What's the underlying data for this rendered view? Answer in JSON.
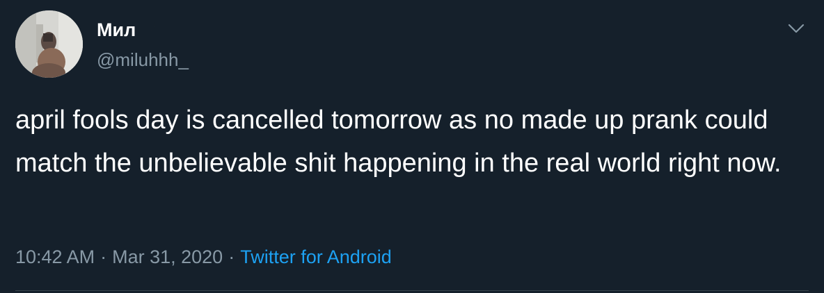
{
  "author": {
    "display_name": "Мил",
    "handle": "@miluhhh_"
  },
  "icons": {
    "avatar": "profile-photo",
    "name_emoji": "crescent-moon-icon",
    "menu": "chevron-down-icon"
  },
  "tweet": {
    "text": "april fools day is cancelled tomorrow as no made up prank could match the unbelievable shit happening in the real world right now.",
    "time": "10:42 AM",
    "date": "Mar 31, 2020",
    "separator": "·",
    "source": "Twitter for Android"
  },
  "colors": {
    "background": "#15202b",
    "text": "#ffffff",
    "secondary": "#8899a6",
    "accent": "#1da1f2",
    "moon": "#ffcc4d"
  }
}
